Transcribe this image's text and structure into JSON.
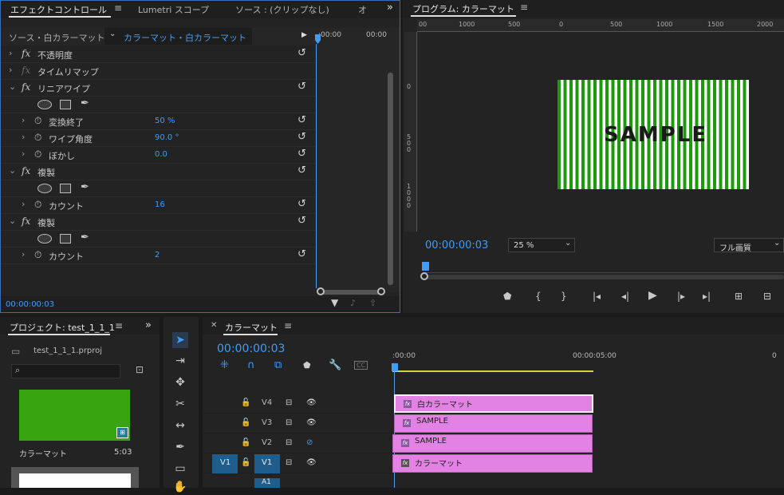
{
  "effect_controls": {
    "tabs": [
      "エフェクトコントロール",
      "Lumetri スコープ",
      "ソース : (クリップなし)",
      "オ"
    ],
    "source_label": "ソース・白カラーマット",
    "clip_label": "カラーマット・白カラーマット",
    "ruler_left": ":00:00",
    "ruler_right": "00:00",
    "timecode": "00:00:00:03",
    "rows": {
      "opacity": "不透明度",
      "time_remap": "タイムリマップ",
      "linear_wipe": "リニアワイプ",
      "transition_completion": "変換終了",
      "transition_completion_value": "50 %",
      "wipe_angle": "ワイプ角度",
      "wipe_angle_value": "90.0 °",
      "feather": "ぼかし",
      "feather_value": "0.0",
      "replicate1": "複製",
      "count1": "カウント",
      "count1_value": "16",
      "replicate2": "複製",
      "count2": "カウント",
      "count2_value": "2"
    }
  },
  "program": {
    "title": "プログラム: カラーマット",
    "ruler_labels": [
      "00",
      "1000",
      "500",
      "0",
      "500",
      "1000",
      "1500",
      "2000"
    ],
    "vruler_labels": [
      "0",
      "5 0 0",
      "1 0 0 0"
    ],
    "sample_text": "SAMPLE",
    "timecode": "00:00:00:03",
    "zoom": "25 %",
    "quality": "フル画質"
  },
  "project": {
    "title": "プロジェクト: test_1_1_1",
    "file": "test_1_1_1.prproj",
    "item_name": "カラーマット",
    "item_duration": "5:03",
    "thumb_color": "#36a50f"
  },
  "timeline": {
    "title": "カラーマット",
    "timecode": "00:00:00:03",
    "ruler_start": ":00:00",
    "ruler_mid": "00:00:05:00",
    "ruler_end": "0",
    "tracks": [
      "V4",
      "V3",
      "V2",
      "V1"
    ],
    "source_patch": "V1",
    "audio_track": "A1",
    "clips": [
      {
        "track": "V4",
        "label": "白カラーマット"
      },
      {
        "track": "V3",
        "label": "SAMPLE"
      },
      {
        "track": "V2",
        "label": "SAMPLE"
      },
      {
        "track": "V1",
        "label": "カラーマット"
      }
    ]
  },
  "colors": {
    "accent": "#3f9df8",
    "clip": "#e282e2",
    "stripe_green": "#1c9a0c"
  }
}
